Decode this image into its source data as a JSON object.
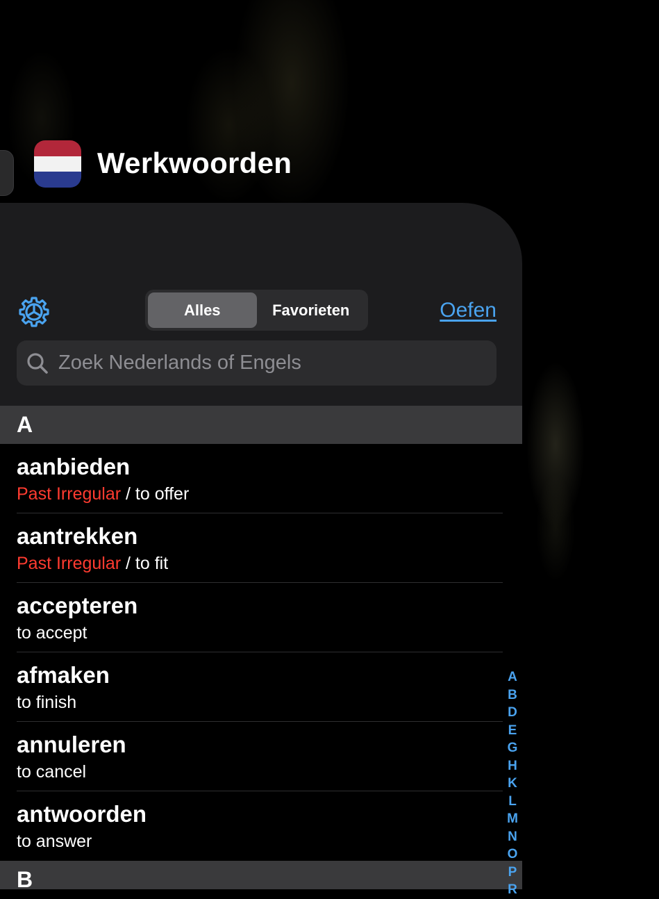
{
  "app": {
    "title": "Werkwoorden"
  },
  "toolbar": {
    "segments": [
      "Alles",
      "Favorieten"
    ],
    "active_segment": "Alles",
    "practice_link": "Oefen"
  },
  "search": {
    "placeholder": "Zoek Nederlands of Engels",
    "value": ""
  },
  "sections": [
    {
      "letter": "A",
      "items": [
        {
          "verb": "aanbieden",
          "tag": "Past Irregular",
          "separator": " / ",
          "translation": "to offer"
        },
        {
          "verb": "aantrekken",
          "tag": "Past Irregular",
          "separator": " / ",
          "translation": "to fit"
        },
        {
          "verb": "accepteren",
          "translation": "to accept"
        },
        {
          "verb": "afmaken",
          "translation": "to finish"
        },
        {
          "verb": "annuleren",
          "translation": "to cancel"
        },
        {
          "verb": "antwoorden",
          "translation": "to answer"
        }
      ]
    },
    {
      "letter": "B",
      "items": []
    }
  ],
  "index_letters": [
    "A",
    "B",
    "D",
    "E",
    "G",
    "H",
    "K",
    "L",
    "M",
    "N",
    "O",
    "P",
    "R"
  ],
  "colors": {
    "accent": "#4aa3ef",
    "irregular": "#ff3b30",
    "panel": "#1c1c1e"
  },
  "icons": {
    "settings": "gear-icon",
    "search": "search-icon"
  }
}
